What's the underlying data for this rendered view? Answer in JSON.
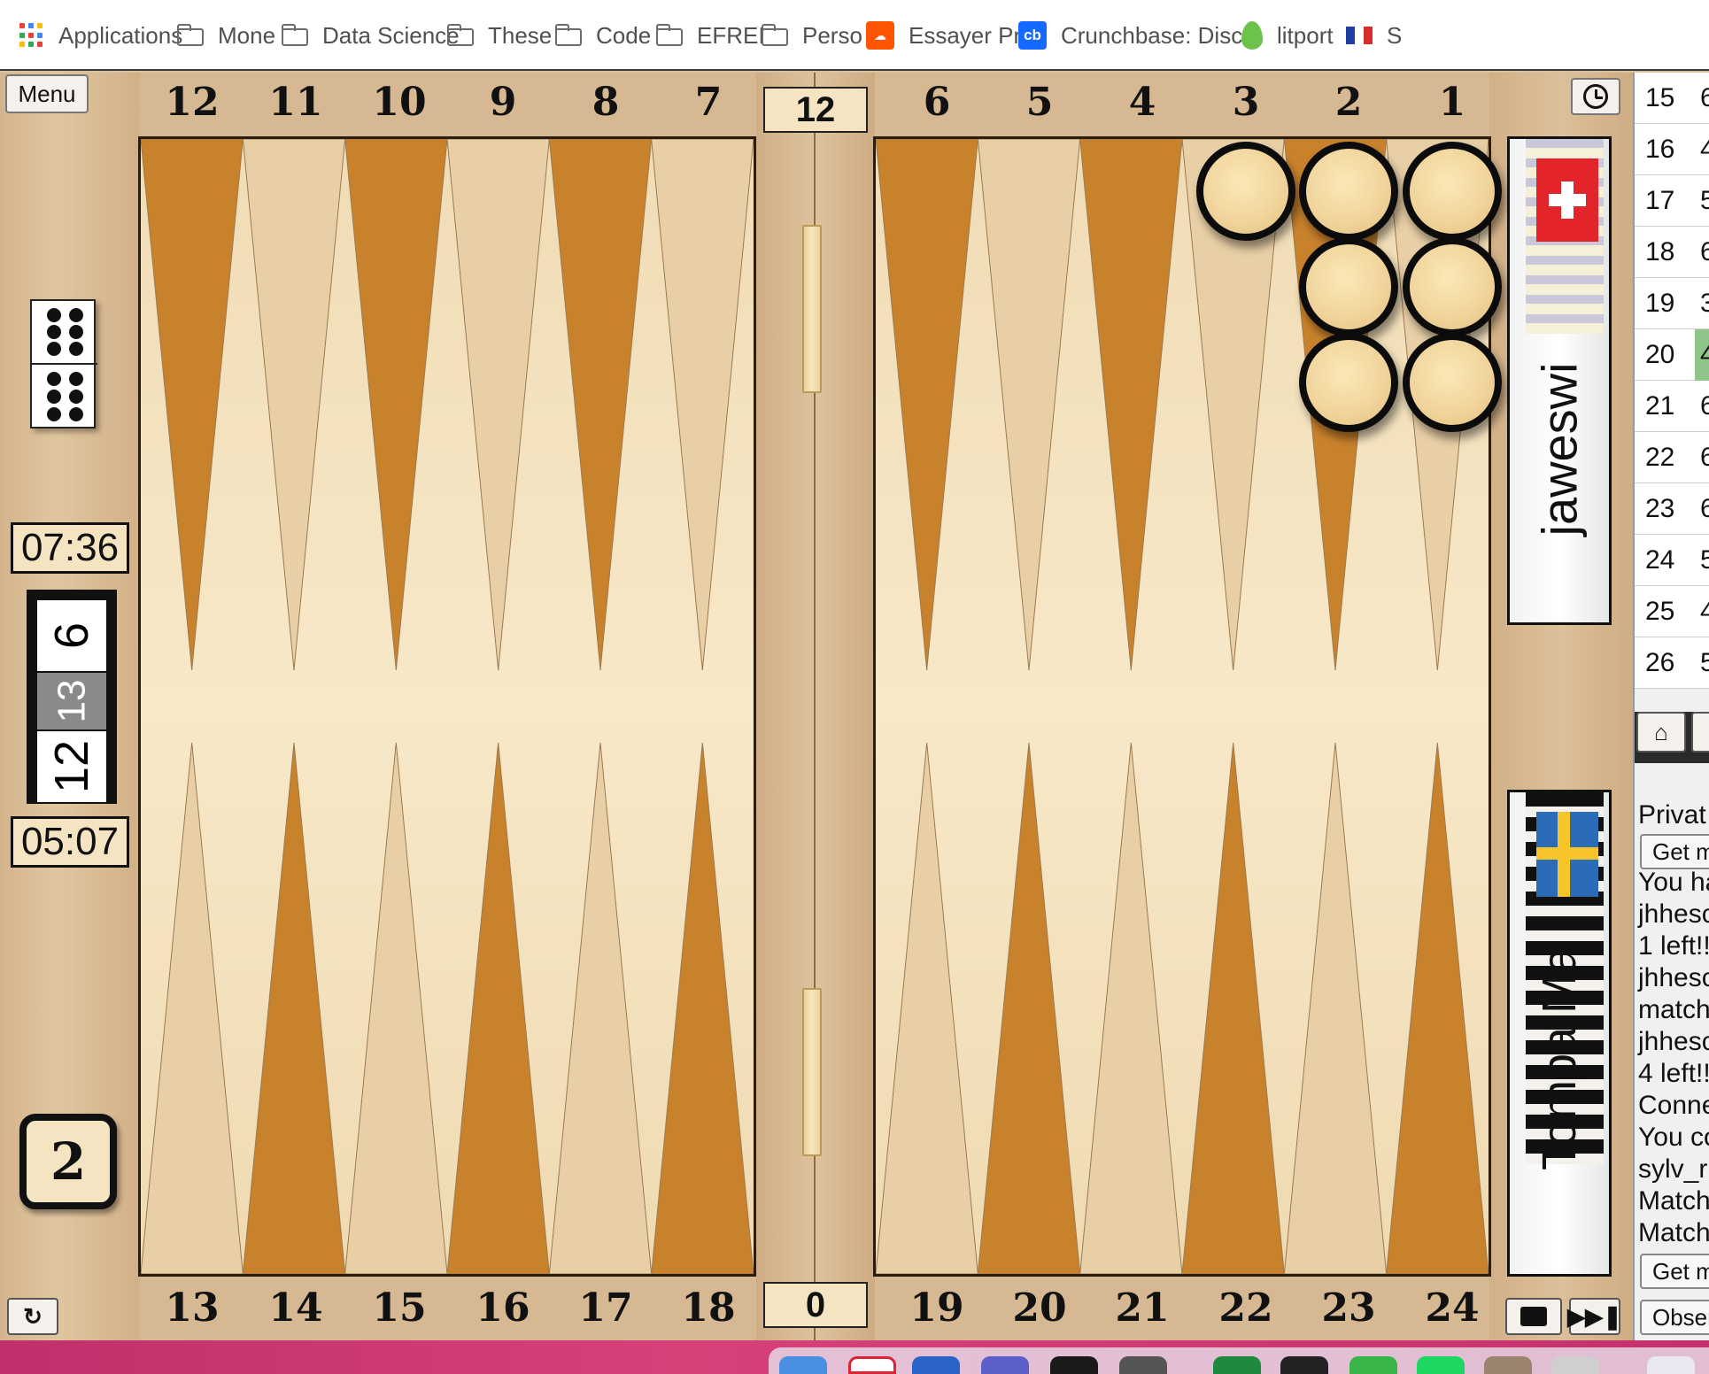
{
  "bookmarks": [
    {
      "label": "Applications",
      "icon": "apps-grid-icon"
    },
    {
      "label": "Mone",
      "icon": "folder-icon"
    },
    {
      "label": "Data Science",
      "icon": "folder-icon"
    },
    {
      "label": "These",
      "icon": "folder-icon"
    },
    {
      "label": "Code",
      "icon": "folder-icon"
    },
    {
      "label": "EFREI",
      "icon": "folder-icon"
    },
    {
      "label": "Perso",
      "icon": "folder-icon"
    },
    {
      "label": "Essayer Pro",
      "icon": "soundcloud-icon"
    },
    {
      "label": "Crunchbase: Disc...",
      "icon": "crunchbase-icon"
    },
    {
      "label": "litport",
      "icon": "leaf-icon"
    },
    {
      "label": "S",
      "icon": "french-flag-icon"
    }
  ],
  "board": {
    "top_points": [
      "12",
      "11",
      "10",
      "9",
      "8",
      "7",
      "6",
      "5",
      "4",
      "3",
      "2",
      "1"
    ],
    "bottom_points": [
      "13",
      "14",
      "15",
      "16",
      "17",
      "18",
      "19",
      "20",
      "21",
      "22",
      "23",
      "24"
    ],
    "pip_top": "12",
    "pip_bottom": "0",
    "checkers": [
      {
        "point": "3",
        "stack": 1
      },
      {
        "point": "2",
        "stack": 1
      },
      {
        "point": "2",
        "stack": 2
      },
      {
        "point": "2",
        "stack": 3
      },
      {
        "point": "1",
        "stack": 1
      },
      {
        "point": "1",
        "stack": 2
      },
      {
        "point": "1",
        "stack": 3
      }
    ],
    "colors": {
      "dark_point": "#c9822c",
      "light_point": "#e8cfa6",
      "checker": "#f3dca8"
    }
  },
  "controls": {
    "menu_label": "Menu",
    "clock_icon": "clock-icon",
    "refresh_icon": "refresh-icon",
    "video_icon": "video-camera-icon",
    "skip_icon": "skip-forward-icon"
  },
  "dice": {
    "value": 6,
    "value2": 6
  },
  "timers": {
    "top": "07:36",
    "bottom": "05:07"
  },
  "score": {
    "top": "6",
    "middle": "13",
    "bottom": "12"
  },
  "cube": {
    "value": "2"
  },
  "players": {
    "top": {
      "name": "jaweswi",
      "flag": "swiss-flag-icon"
    },
    "bottom": {
      "name": "Tompa Ma",
      "flag": "swedish-flag-icon"
    }
  },
  "panel": {
    "rounds": [
      {
        "n": "15",
        "v": "6"
      },
      {
        "n": "16",
        "v": "4"
      },
      {
        "n": "17",
        "v": "5"
      },
      {
        "n": "18",
        "v": "6"
      },
      {
        "n": "19",
        "v": "3"
      },
      {
        "n": "20",
        "v": "4",
        "highlight": true
      },
      {
        "n": "21",
        "v": "6"
      },
      {
        "n": "22",
        "v": "6"
      },
      {
        "n": "23",
        "v": "6"
      },
      {
        "n": "24",
        "v": "5"
      },
      {
        "n": "25",
        "v": "4"
      },
      {
        "n": "26",
        "v": "5"
      }
    ],
    "home_icon": "home-icon",
    "private_label": "Privat",
    "get_btn_top": "Get m",
    "chat_lines": [
      "You ha",
      "jhhesc",
      "1 left!!",
      "jhhesc",
      "match",
      "jhhesc",
      "4 left!!",
      "Conne",
      "You co",
      "sylv_r",
      "Match",
      "Match"
    ],
    "get_btn_bottom": "Get m",
    "observe_label": "Obser"
  }
}
